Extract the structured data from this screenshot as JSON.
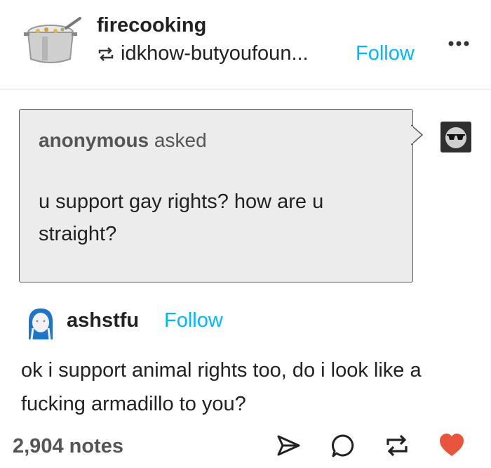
{
  "post": {
    "blog_name": "firecooking",
    "reblogged_from": "idkhow-butyoufoun...",
    "follow_label": "Follow"
  },
  "ask": {
    "asker": "anonymous",
    "asked_label": "asked",
    "question": "u support gay rights? how are u straight?"
  },
  "answer": {
    "author": "ashstfu",
    "follow_label": "Follow",
    "text": "ok i support animal rights too, do i look like a fucking armadillo to you?"
  },
  "footer": {
    "notes": "2,904 notes"
  },
  "colors": {
    "accent": "#00b8ff",
    "like": "#e8553c",
    "ask_bg": "#ececec"
  }
}
